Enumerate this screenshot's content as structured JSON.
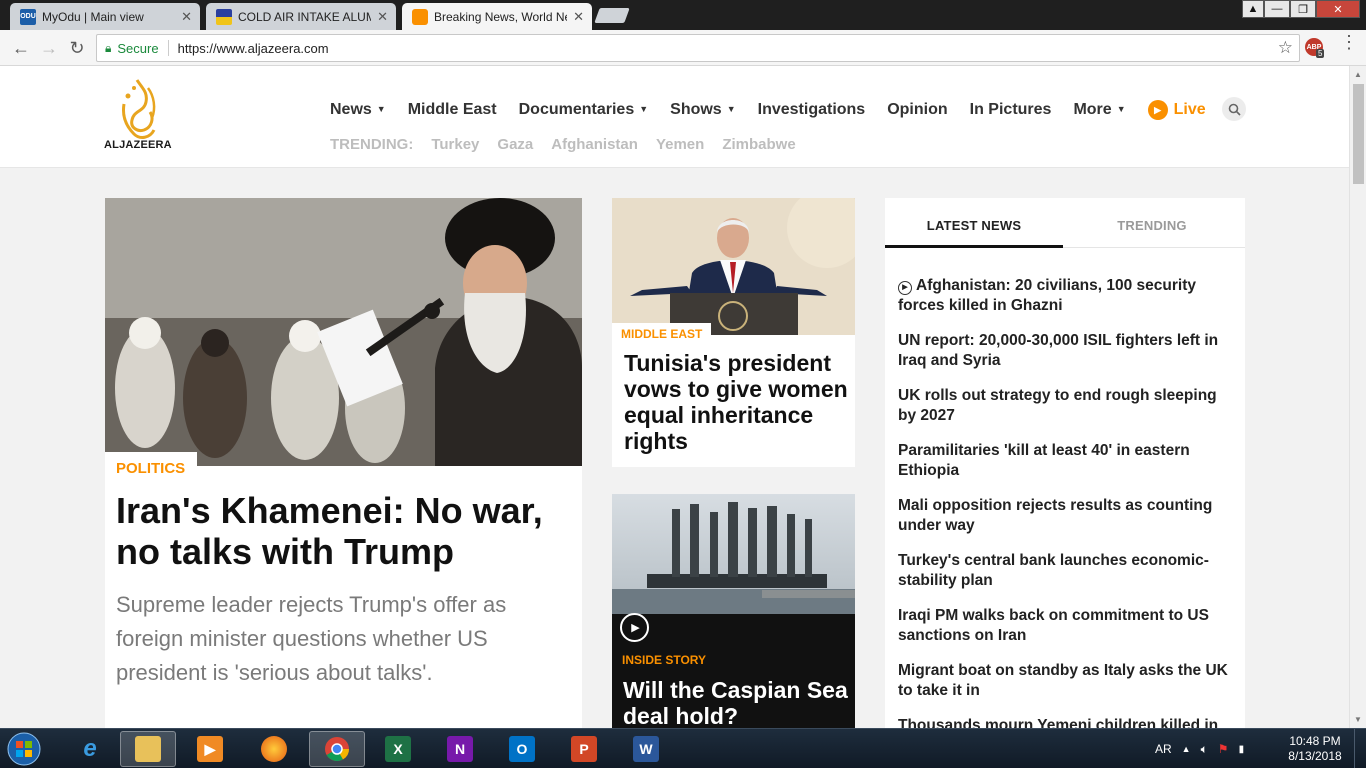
{
  "browser": {
    "tabs": [
      {
        "title": "MyOdu | Main view"
      },
      {
        "title": "COLD AIR INTAKE ALUMI"
      },
      {
        "title": "Breaking News, World Ne"
      }
    ],
    "secure_label": "Secure",
    "url": "https://www.aljazeera.com",
    "ext_badge": "ABP",
    "ext_count": "5"
  },
  "site": {
    "logo_text": "ALJAZEERA",
    "nav": [
      "News",
      "Middle East",
      "Documentaries",
      "Shows",
      "Investigations",
      "Opinion",
      "In Pictures",
      "More"
    ],
    "live_label": "Live",
    "trending_label": "TRENDING:",
    "trending": [
      "Turkey",
      "Gaza",
      "Afghanistan",
      "Yemen",
      "Zimbabwe"
    ]
  },
  "hero": {
    "category": "POLITICS",
    "title": "Iran's Khamenei: No war, no talks with Trump",
    "summary": "Supreme leader rejects Trump's offer as foreign minister questions whether US president is 'serious about talks'."
  },
  "card1": {
    "category": "MIDDLE EAST",
    "title": "Tunisia's president vows to give women equal inheritance rights"
  },
  "card2": {
    "category": "INSIDE STORY",
    "title": "Will the Caspian Sea deal hold?"
  },
  "panel": {
    "tab_latest": "LATEST NEWS",
    "tab_trending": "TRENDING",
    "items": [
      "Afghanistan: 20 civilians, 100 security forces killed in Ghazni",
      "UN report: 20,000-30,000 ISIL fighters left in Iraq and Syria",
      "UK rolls out strategy to end rough sleeping by 2027",
      "Paramilitaries 'kill at least 40' in eastern Ethiopia",
      "Mali opposition rejects results as counting under way",
      "Turkey's central bank launches economic-stability plan",
      "Iraqi PM walks back on commitment to US sanctions on Iran",
      "Migrant boat on standby as Italy asks the UK to take it in",
      "Thousands mourn Yemeni children killed in"
    ]
  },
  "taskbar": {
    "apps": [
      "internet-explorer",
      "file-explorer",
      "media-player",
      "firefox",
      "chrome",
      "excel",
      "onenote",
      "outlook",
      "powerpoint",
      "word"
    ],
    "lang": "AR",
    "time": "10:48 PM",
    "date": "8/13/2018"
  },
  "colors": {
    "accent": "#fa9000",
    "headline": "#111111",
    "summary": "#7a7a7a",
    "trending": "#bdbdbd",
    "secure": "#1b8a3c"
  }
}
